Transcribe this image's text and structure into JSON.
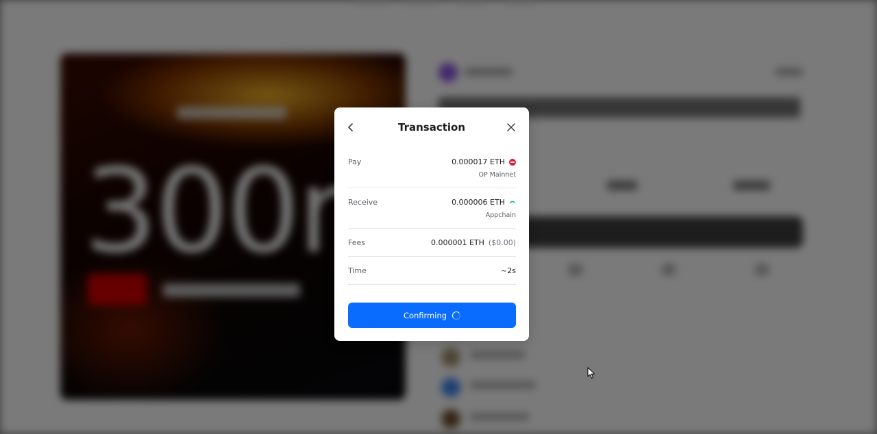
{
  "modal": {
    "title": "Transaction",
    "rows": {
      "pay": {
        "label": "Pay",
        "amount": "0.000017 ETH",
        "network": "OP Mainnet",
        "network_icon": "op-mainnet-icon"
      },
      "receive": {
        "label": "Receive",
        "amount": "0.000006 ETH",
        "network": "Appchain",
        "network_icon": "appchain-icon"
      },
      "fees": {
        "label": "Fees",
        "amount": "0.000001 ETH",
        "usd": "($0.00)"
      },
      "time": {
        "label": "Time",
        "value": "~2s"
      }
    },
    "button": {
      "label": "Confirming",
      "state": "loading"
    }
  },
  "colors": {
    "accent": "#0a6cff",
    "op_red": "#e01935",
    "appchain_teal": "#13b3a4",
    "overlay": "rgba(0,0,0,0.5)"
  }
}
